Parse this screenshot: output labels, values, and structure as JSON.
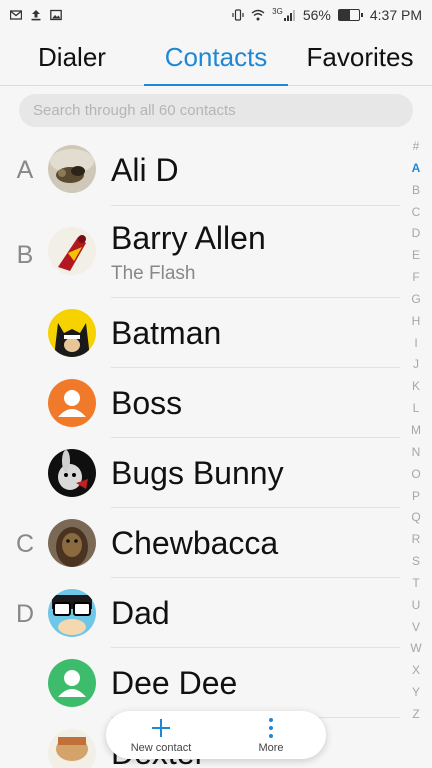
{
  "status": {
    "battery": "56%",
    "time": "4:37 PM",
    "net": "3G"
  },
  "tabs": [
    {
      "label": "Dialer"
    },
    {
      "label": "Contacts"
    },
    {
      "label": "Favorites"
    }
  ],
  "search": {
    "placeholder": "Search through all 60 contacts"
  },
  "contacts": [
    {
      "letter": "A",
      "name": "Ali D",
      "subtitle": ""
    },
    {
      "letter": "B",
      "name": "Barry Allen",
      "subtitle": "The Flash"
    },
    {
      "letter": "",
      "name": "Batman",
      "subtitle": ""
    },
    {
      "letter": "",
      "name": "Boss",
      "subtitle": ""
    },
    {
      "letter": "",
      "name": "Bugs Bunny",
      "subtitle": ""
    },
    {
      "letter": "C",
      "name": "Chewbacca",
      "subtitle": ""
    },
    {
      "letter": "D",
      "name": "Dad",
      "subtitle": ""
    },
    {
      "letter": "",
      "name": "Dee Dee",
      "subtitle": ""
    },
    {
      "letter": "",
      "name": "Dexter",
      "subtitle": ""
    }
  ],
  "index_letters": [
    "#",
    "A",
    "B",
    "C",
    "D",
    "E",
    "F",
    "G",
    "H",
    "I",
    "J",
    "K",
    "L",
    "M",
    "N",
    "O",
    "P",
    "Q",
    "R",
    "S",
    "T",
    "U",
    "V",
    "W",
    "X",
    "Y",
    "Z"
  ],
  "fab": {
    "new_contact": "New contact",
    "more": "More"
  },
  "colors": {
    "accent": "#1e88d6",
    "placeholder_orange": "#f07a2a",
    "placeholder_green": "#3dbd6c"
  }
}
